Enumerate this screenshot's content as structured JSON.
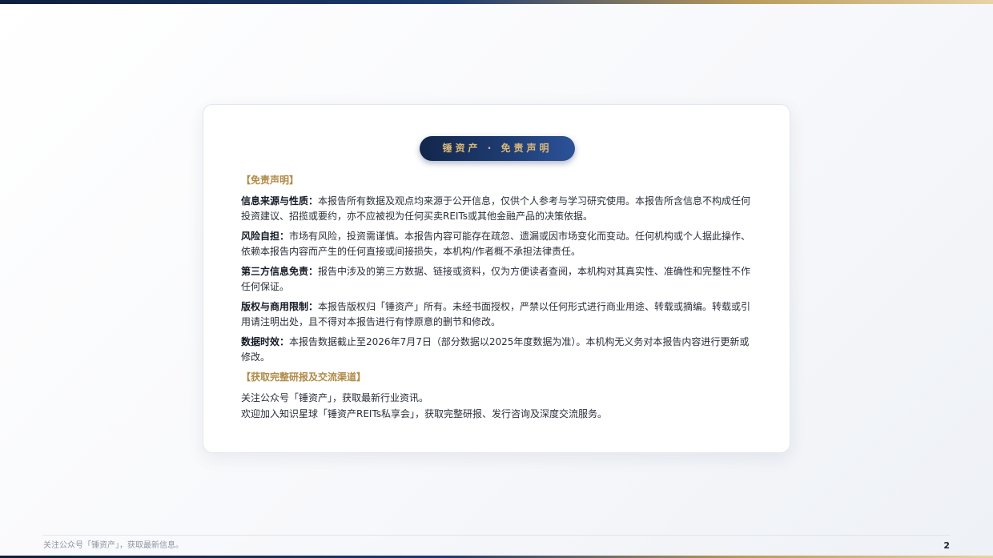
{
  "header": {
    "pill_label": "锤资产 · 免责声明"
  },
  "disclaimer": {
    "section_title": "【免责声明】",
    "items": [
      {
        "term": "信息来源与性质",
        "sep": "：",
        "text": "本报告所有数据及观点均来源于公开信息，仅供个人参考与学习研究使用。本报告所含信息不构成任何投资建议、招揽或要约，亦不应被视为任何买卖REITs或其他金融产品的决策依据。"
      },
      {
        "term": "风险自担",
        "sep": "：",
        "text": "市场有风险，投资需谨慎。本报告内容可能存在疏忽、遗漏或因市场变化而变动。任何机构或个人据此操作、依赖本报告内容而产生的任何直接或间接损失，本机构/作者概不承担法律责任。"
      },
      {
        "term": "第三方信息免责",
        "sep": "：",
        "text": "报告中涉及的第三方数据、链接或资料，仅为方便读者查阅，本机构对其真实性、准确性和完整性不作任何保证。"
      },
      {
        "term": "版权与商用限制",
        "sep": "：",
        "text": "本报告版权归「锤资产」所有。未经书面授权，严禁以任何形式进行商业用途、转载或摘编。转载或引用请注明出处，且不得对本报告进行有悖原意的删节和修改。"
      },
      {
        "term": "数据时效",
        "sep": "：",
        "text": "本报告数据截止至2026年7月7日（部分数据以2025年度数据为准）。本机构无义务对本报告内容进行更新或修改。"
      }
    ]
  },
  "channels": {
    "section_title": "【获取完整研报及交流渠道】",
    "lines": [
      "关注公众号「锤资产」，获取最新行业资讯。",
      "欢迎加入知识星球「锤资产REITs私享会」，获取完整研报、发行咨询及深度交流服务。"
    ]
  },
  "footer": {
    "text": "关注公众号「锤资产」，获取最新信息。",
    "page_number": "2"
  }
}
